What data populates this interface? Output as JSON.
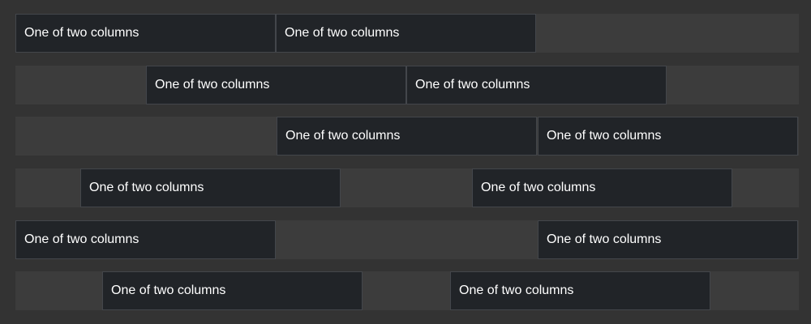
{
  "rows": [
    {
      "columns": [
        {
          "label": "One of two columns"
        },
        {
          "label": "One of two columns"
        }
      ]
    },
    {
      "columns": [
        {
          "label": "One of two columns"
        },
        {
          "label": "One of two columns"
        }
      ]
    },
    {
      "columns": [
        {
          "label": "One of two columns"
        },
        {
          "label": "One of two columns"
        }
      ]
    },
    {
      "columns": [
        {
          "label": "One of two columns"
        },
        {
          "label": "One of two columns"
        }
      ]
    },
    {
      "columns": [
        {
          "label": "One of two columns"
        },
        {
          "label": "One of two columns"
        }
      ]
    },
    {
      "columns": [
        {
          "label": "One of two columns"
        },
        {
          "label": "One of two columns"
        }
      ]
    }
  ],
  "colors": {
    "page_background": "#333333",
    "row_background": "#3c3c3c",
    "column_background": "#212428",
    "column_border": "#43464b",
    "text": "#ffffff"
  }
}
